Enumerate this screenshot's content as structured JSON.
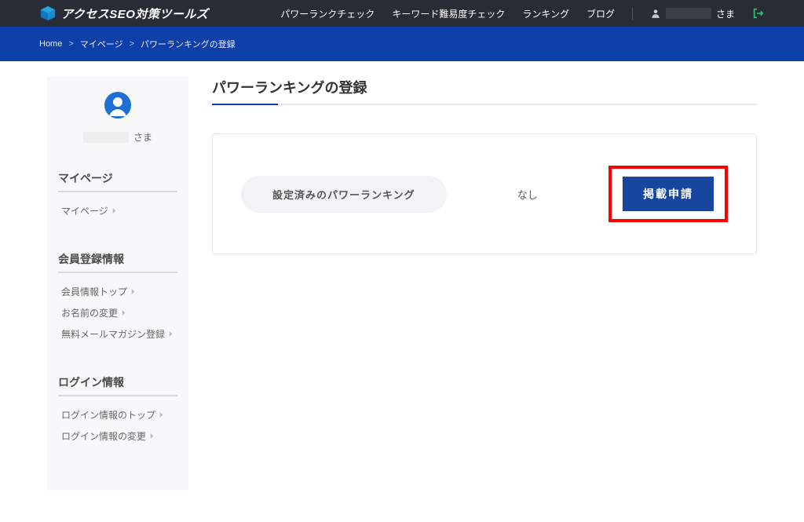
{
  "header": {
    "logo_text": "アクセスSEO対策ツールズ",
    "nav": {
      "power_rank_check": "パワーランクチェック",
      "keyword_difficulty": "キーワード難易度チェック",
      "ranking": "ランキング",
      "blog": "ブログ"
    },
    "user_suffix": "さま"
  },
  "breadcrumb": {
    "home": "Home",
    "mypage": "マイページ",
    "current": "パワーランキングの登録"
  },
  "sidebar": {
    "user_suffix": "さま",
    "sections": {
      "mypage": {
        "title": "マイページ",
        "items": {
          "top": "マイページ"
        }
      },
      "account": {
        "title": "会員登録情報",
        "items": {
          "top": "会員情報トップ",
          "name_change": "お名前の変更",
          "mailmag": "無料メールマガジン登録"
        }
      },
      "login": {
        "title": "ログイン情報",
        "items": {
          "top": "ログイン情報のトップ",
          "change": "ログイン情報の変更"
        }
      }
    }
  },
  "main": {
    "title": "パワーランキングの登録",
    "card": {
      "pill_label": "設定済みのパワーランキング",
      "status": "なし",
      "apply_button": "掲載申請"
    }
  }
}
